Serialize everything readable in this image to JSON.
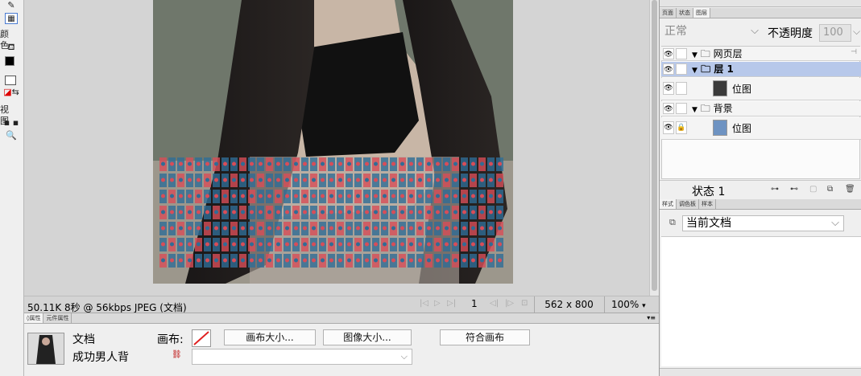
{
  "toolbar": {
    "labels": {
      "colors": "颜色",
      "view": "视图"
    }
  },
  "status": {
    "file_info": "50.11K 8秒 @ 56kbps JPEG (文档)",
    "frame": "1",
    "size": "562 x 800",
    "zoom": "100%"
  },
  "props": {
    "tabs": [
      "属性",
      "元件属性"
    ],
    "doc_label": "文档",
    "doc_name": "成功男人背",
    "canvas_label": "画布:",
    "canvas_size_btn": "画布大小...",
    "image_size_btn": "图像大小...",
    "fit_canvas_btn": "符合画布"
  },
  "layers_panel": {
    "tabs": [
      "页面",
      "状态",
      "图层"
    ],
    "blend_mode": "正常",
    "opacity_label": "不透明度",
    "opacity_value": "100",
    "rows": [
      {
        "name": "网页层"
      },
      {
        "name": "层 1"
      },
      {
        "name": "位图"
      },
      {
        "name": "背景"
      },
      {
        "name": "位图"
      }
    ],
    "state_label": "状态 1"
  },
  "styles_panel": {
    "tabs": [
      "样式",
      "调色板",
      "样本"
    ],
    "selected": "当前文档"
  },
  "colors": {
    "selected_row": "#b7c8ea",
    "mosaic_blue": "#2f6d96",
    "mosaic_red": "#d84d58"
  }
}
